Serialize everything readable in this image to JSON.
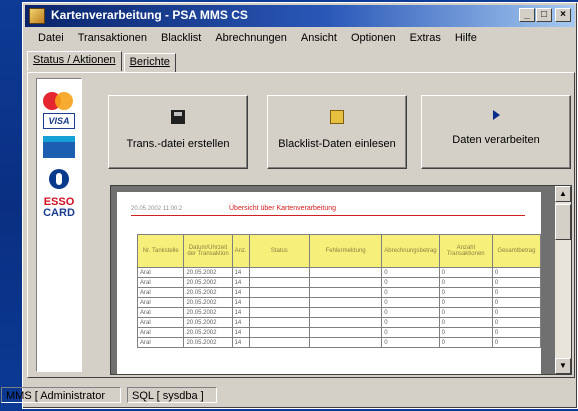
{
  "window": {
    "title": "Kartenverarbeitung - PSA MMS CS",
    "controls": {
      "minimize": "_",
      "maximize": "□",
      "close": "×"
    }
  },
  "menu": [
    "Datei",
    "Transaktionen",
    "Blacklist",
    "Abrechnungen",
    "Ansicht",
    "Optionen",
    "Extras",
    "Hilfe"
  ],
  "tabs": [
    {
      "label": "Status / Aktionen",
      "active": true
    },
    {
      "label": "Berichte",
      "active": false
    }
  ],
  "cards": [
    "MasterCard",
    "VISA",
    "Maestro",
    "Diners",
    "ESSO CARD"
  ],
  "actions": {
    "create_file": "Trans.-datei erstellen",
    "read_blacklist": "Blacklist-Daten einlesen",
    "process_data": "Daten verarbeiten"
  },
  "report": {
    "date": "20.05.2002 11:00:2",
    "title": "Übersicht über Kartenverarbeitung",
    "headers": [
      "Nr. Tankstelle",
      "Datum/Uhrzeit der Transaktion",
      "Anz.",
      "Status",
      "Fehlermeldung",
      "Abrechnungsbetrag",
      "Anzahl Transaktionen",
      "Gesamtbetrag"
    ],
    "rows": [
      [
        "Aral",
        "20.05.2002",
        "14",
        "",
        "",
        "0",
        "0",
        "0"
      ],
      [
        "Aral",
        "20.05.2002",
        "14",
        "",
        "",
        "0",
        "0",
        "0"
      ],
      [
        "Aral",
        "20.05.2002",
        "14",
        "",
        "",
        "0",
        "0",
        "0"
      ],
      [
        "Aral",
        "20.05.2002",
        "14",
        "",
        "",
        "0",
        "0",
        "0"
      ],
      [
        "Aral",
        "20.05.2002",
        "14",
        "",
        "",
        "0",
        "0",
        "0"
      ],
      [
        "Aral",
        "20.05.2002",
        "14",
        "",
        "",
        "0",
        "0",
        "0"
      ],
      [
        "Aral",
        "20.05.2002",
        "14",
        "",
        "",
        "0",
        "0",
        "0"
      ],
      [
        "Aral",
        "20.05.2002",
        "14",
        "",
        "",
        "0",
        "0",
        "0"
      ]
    ]
  },
  "status": {
    "user": "MMS [ Administrator",
    "db": "SQL [ sysdba ]"
  }
}
